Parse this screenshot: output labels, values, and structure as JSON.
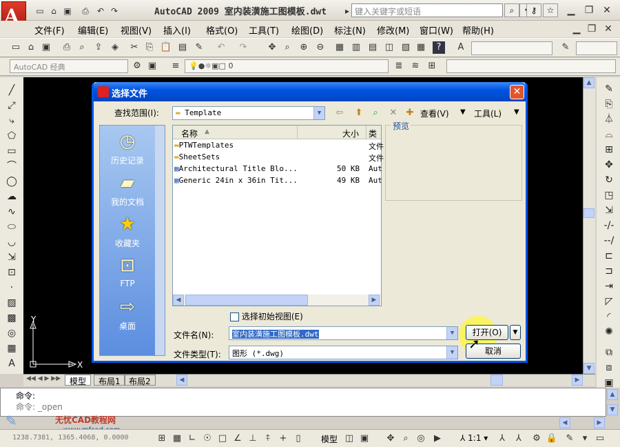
{
  "app": {
    "title": "AutoCAD 2009  室内装潢施工图模板.dwt",
    "search_placeholder": "键入关键字或短语"
  },
  "menu": [
    "文件(F)",
    "编辑(E)",
    "视图(V)",
    "插入(I)",
    "格式(O)",
    "工具(T)",
    "绘图(D)",
    "标注(N)",
    "修改(M)",
    "窗口(W)",
    "帮助(H)"
  ],
  "workspace": "AutoCAD 经典",
  "layer": "0",
  "dialog": {
    "title": "选择文件",
    "lookin_label": "查找范围(I):",
    "lookin_value": "Template",
    "view_label": "查看(V)",
    "tools_label": "工具(L)",
    "columns": {
      "name": "名称",
      "size": "大小",
      "type": "类"
    },
    "files": [
      {
        "name": "PTWTemplates",
        "size": "",
        "type": "文件"
      },
      {
        "name": "SheetSets",
        "size": "",
        "type": "文件"
      },
      {
        "name": "Architectural Title Blo...",
        "size": "50 KB",
        "type": "Aut"
      },
      {
        "name": "Generic 24in x 36in Tit...",
        "size": "49 KB",
        "type": "Aut"
      }
    ],
    "preview_label": "预览",
    "places": [
      "历史记录",
      "我的文档",
      "收藏夹",
      "FTP",
      "桌面"
    ],
    "initial_view_label": "选择初始视图(E)",
    "filename_label": "文件名(N):",
    "filename_value": "室内装潢施工图模板.dwt",
    "filetype_label": "文件类型(T):",
    "filetype_value": "图形 (*.dwg)",
    "open_button": "打开(O)",
    "cancel_button": "取消"
  },
  "tabs": [
    "模型",
    "布局1",
    "布局2"
  ],
  "command": {
    "line1": "命令:",
    "line2": "命令: _open"
  },
  "status": {
    "coords": "1238.7381, 1365.4068, 0.0000",
    "model": "模型",
    "scale": "1:1"
  },
  "watermark": {
    "name": "无忧CAD教程网",
    "url": "www.mfcad.com"
  },
  "colors": {
    "dialog_border": "#0054e3",
    "canvas": "#000000"
  }
}
